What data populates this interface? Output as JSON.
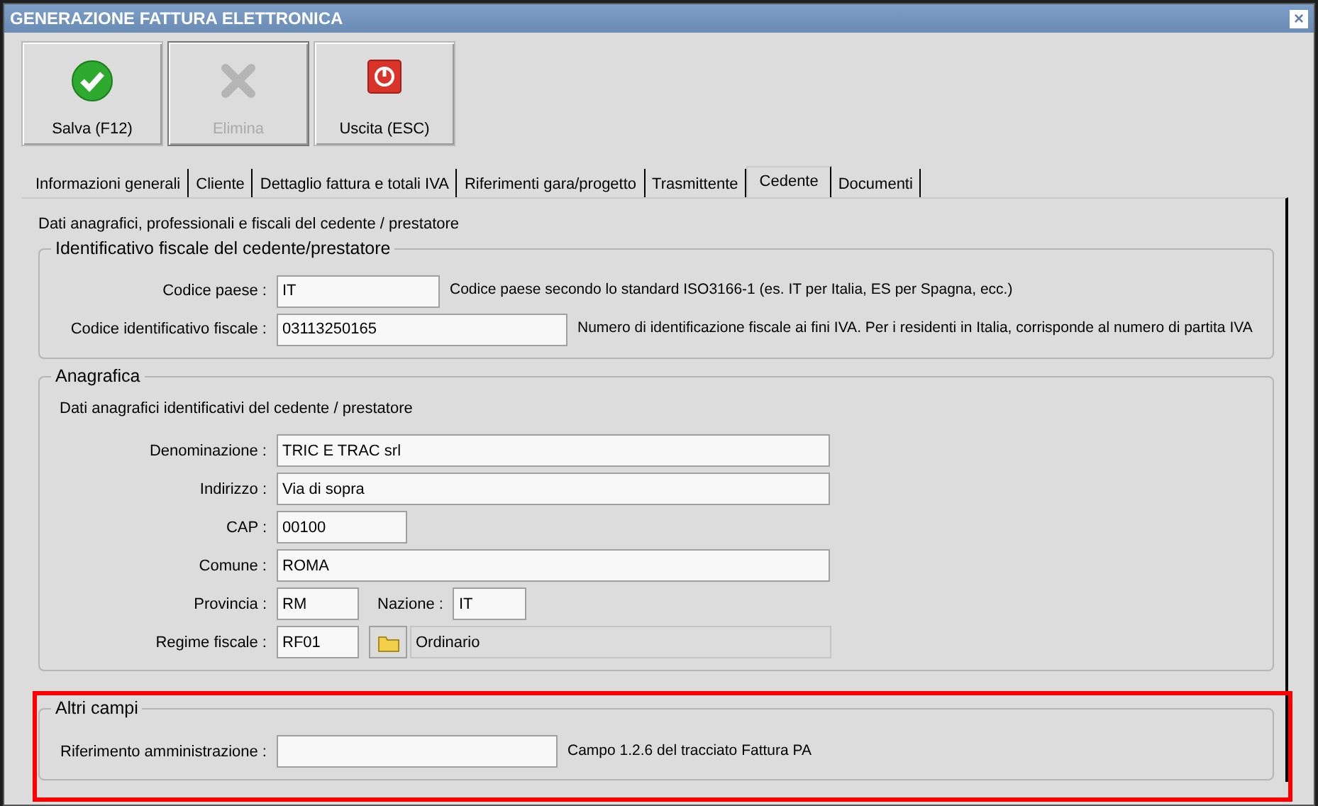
{
  "window": {
    "title": "GENERAZIONE FATTURA ELETTRONICA",
    "close": "×"
  },
  "toolbar": [
    {
      "label": "Salva (F12)",
      "kind": "save",
      "disabled": false
    },
    {
      "label": "Elimina",
      "kind": "delete",
      "disabled": true
    },
    {
      "label": "Uscita (ESC)",
      "kind": "exit",
      "disabled": false
    }
  ],
  "tabs": [
    {
      "label": "Informazioni generali",
      "selected": false
    },
    {
      "label": "Cliente",
      "selected": false
    },
    {
      "label": "Dettaglio fattura e totali IVA",
      "selected": false
    },
    {
      "label": "Riferimenti gara/progetto",
      "selected": false
    },
    {
      "label": "Trasmittente",
      "selected": false
    },
    {
      "label": "Cedente",
      "selected": true
    },
    {
      "label": "Documenti",
      "selected": false
    }
  ],
  "panel": {
    "description": "Dati anagrafici, professionali e fiscali del cedente / prestatore",
    "groups": [
      {
        "legend": "Identificativo fiscale del cedente/prestatore",
        "rows": [
          {
            "fields": [
              {
                "kind": "text",
                "label": "Codice paese :",
                "value": "IT"
              }
            ],
            "hint": "Codice paese secondo lo standard ISO3166-1 (es. IT per Italia, ES per Spagna, ecc.)"
          },
          {
            "fields": [
              {
                "kind": "text",
                "label": "Codice identificativo fiscale :",
                "value": "03113250165"
              }
            ],
            "hint": "Numero di identificazione fiscale ai fini IVA. Per i residenti in Italia, corrisponde al numero di partita IVA"
          }
        ]
      },
      {
        "legend": "Anagrafica",
        "description": "Dati anagrafici identificativi del cedente / prestatore",
        "rows": [
          {
            "fields": [
              {
                "kind": "text",
                "label": "Denominazione :",
                "value": "TRIC E TRAC srl"
              }
            ]
          },
          {
            "fields": [
              {
                "kind": "text",
                "label": "Indirizzo :",
                "value": "Via di sopra"
              }
            ]
          },
          {
            "fields": [
              {
                "kind": "text",
                "label": "CAP :",
                "value": "00100"
              }
            ]
          },
          {
            "fields": [
              {
                "kind": "text",
                "label": "Comune :",
                "value": "ROMA"
              }
            ]
          },
          {
            "fields": [
              {
                "kind": "text",
                "label": "Provincia :",
                "value": "RM"
              },
              {
                "kind": "text",
                "label": "Nazione :",
                "value": "IT"
              }
            ]
          },
          {
            "fields": [
              {
                "kind": "lookup",
                "label": "Regime fiscale :",
                "value": "RF01",
                "description": "Ordinario"
              }
            ]
          }
        ]
      },
      {
        "legend": "Altri campi",
        "highlighted": true,
        "rows": [
          {
            "fields": [
              {
                "kind": "text",
                "label": "Riferimento amministrazione :"
              }
            ],
            "hint": "Campo 1.2.6 del tracciato Fattura PA"
          }
        ]
      }
    ]
  }
}
